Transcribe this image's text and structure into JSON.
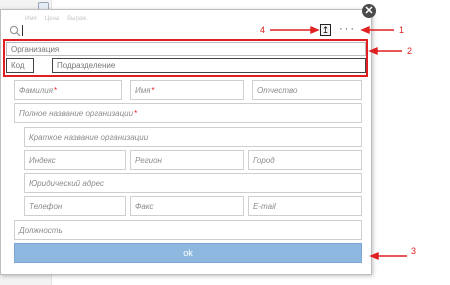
{
  "background": {
    "faint_tabs": [
      "Имя",
      "Цена",
      "Выраж."
    ]
  },
  "dialog": {
    "close_glyph": "✕",
    "toolbar": {
      "upload_glyph": "↥",
      "more_glyph": "···"
    },
    "org_field": {
      "placeholder": "Организация"
    },
    "code_field": {
      "placeholder": "Код"
    },
    "division_field": {
      "placeholder": "Подразделение"
    },
    "person": {
      "last_name": "Фамилия",
      "first_name": "Имя",
      "patronymic": "Отчество",
      "required_mark": "*"
    },
    "org_details": {
      "full_name": "Полное название организации",
      "short_name": "Краткое название организации",
      "index": "Индекс",
      "region": "Регион",
      "city": "Город",
      "legal_address": "Юридический адрес",
      "phone": "Телефон",
      "fax": "Факс",
      "email": "E-mail"
    },
    "position": "Должность",
    "ok_label": "ok"
  },
  "annotations": {
    "a1": "1",
    "a2": "2",
    "a3": "3",
    "a4": "4"
  },
  "colors": {
    "annotation_red": "#e02020",
    "ok_button": "#8fb8e1"
  }
}
